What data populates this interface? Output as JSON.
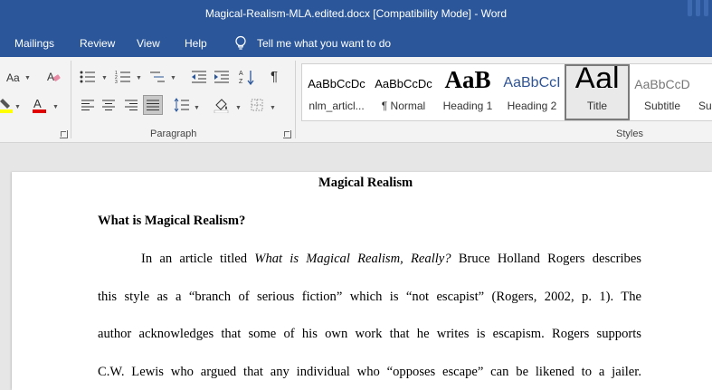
{
  "titlebar": {
    "title": "Magical-Realism-MLA.edited.docx [Compatibility Mode]  -  Word"
  },
  "menubar": {
    "tabs": [
      "Mailings",
      "Review",
      "View",
      "Help"
    ],
    "tell_me": "Tell me what you want to do"
  },
  "ribbon": {
    "font_size_label": "Aa",
    "paragraph_label": "Paragraph",
    "styles_label": "Styles",
    "highlight_color": "#ffff00",
    "font_color": "#e00000",
    "styles": [
      {
        "preview": "AaBbCcDc",
        "name": "nlm_articl..."
      },
      {
        "preview": "AaBbCcDc",
        "name": "¶ Normal"
      },
      {
        "preview": "AaB",
        "name": "Heading 1"
      },
      {
        "preview": "AaBbCcI",
        "name": "Heading 2"
      },
      {
        "preview": "Aal",
        "name": "Title"
      },
      {
        "preview": "AaBbCcD",
        "name": "Subtitle"
      },
      {
        "preview": "",
        "name": "Su"
      }
    ]
  },
  "document": {
    "title": "Magical Realism",
    "heading": "What is Magical Realism?",
    "para1_start": "In an article titled ",
    "para1_italic": "What is Magical Realism, Really?",
    "para1_rest": " Bruce Holland Rogers describes",
    "line2": "this style as a “branch of serious fiction” which is “not escapist” (Rogers, 2002, p. 1). The",
    "line3": "author acknowledges that some of his own work that he writes is escapism. Rogers supports",
    "line4": "C.W. Lewis who argued that any individual who “opposes escape” can be likened to a jailer."
  }
}
